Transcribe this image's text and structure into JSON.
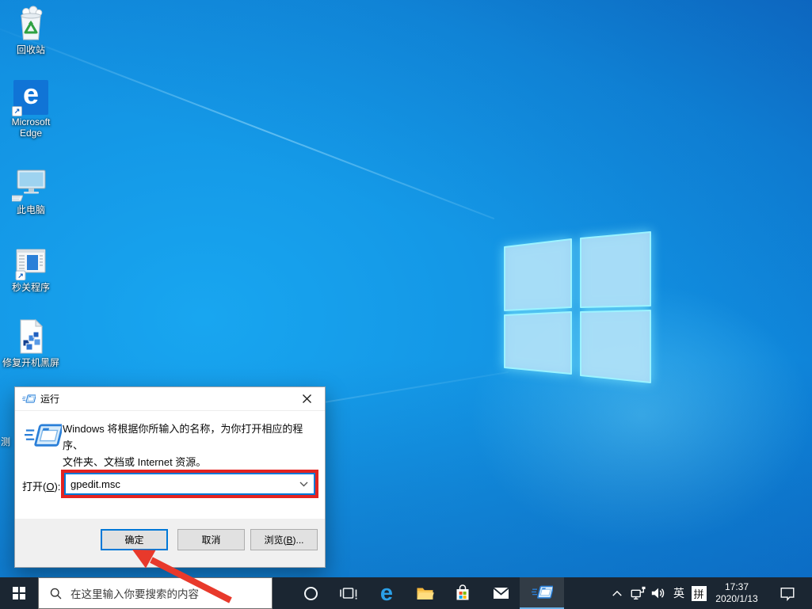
{
  "desktop_icons": [
    {
      "label": "回收站"
    },
    {
      "label": "Microsoft Edge"
    },
    {
      "label": "此电脑"
    },
    {
      "label": "秒关程序"
    },
    {
      "label": "修复开机黑屏"
    },
    {
      "label": "测"
    }
  ],
  "run_dialog": {
    "title": "运行",
    "description_line1": "Windows 将根据你所输入的名称，为你打开相应的程序、",
    "description_line2": "文件夹、文档或 Internet 资源。",
    "open_label": {
      "pre": "打开(",
      "key": "O",
      "post": "):"
    },
    "input_value": "gpedit.msc",
    "ok": "确定",
    "cancel": "取消",
    "browse": {
      "pre": "浏览(",
      "key": "B",
      "post": ")..."
    }
  },
  "taskbar": {
    "search_placeholder": "在这里输入你要搜索的内容",
    "tray": {
      "ime_language": "英",
      "ime_mode": "拼",
      "time": "17:37",
      "date": "2020/1/13"
    }
  },
  "icons": [
    "recycle-bin-icon",
    "edge-icon",
    "this-pc-icon",
    "app-window-icon",
    "registry-file-icon",
    "run-icon",
    "close-icon",
    "combo-chevron-icon",
    "start-icon",
    "search-icon",
    "cortana-icon",
    "task-view-icon",
    "explorer-icon",
    "store-icon",
    "mail-icon",
    "tray-chevron-icon",
    "network-icon",
    "volume-icon",
    "ime-box-icon",
    "action-center-icon",
    "windows-logo-wallpaper",
    "shortcut-arrow-badge",
    "annotation-arrow",
    "annotation-highlight-box"
  ],
  "colors": {
    "accent": "#0078d7",
    "annotation_red": "#e32321",
    "taskbar_bg": "#1b2632",
    "desktop_base": "#0f86da",
    "logo_glow": "#8cf0ff"
  }
}
